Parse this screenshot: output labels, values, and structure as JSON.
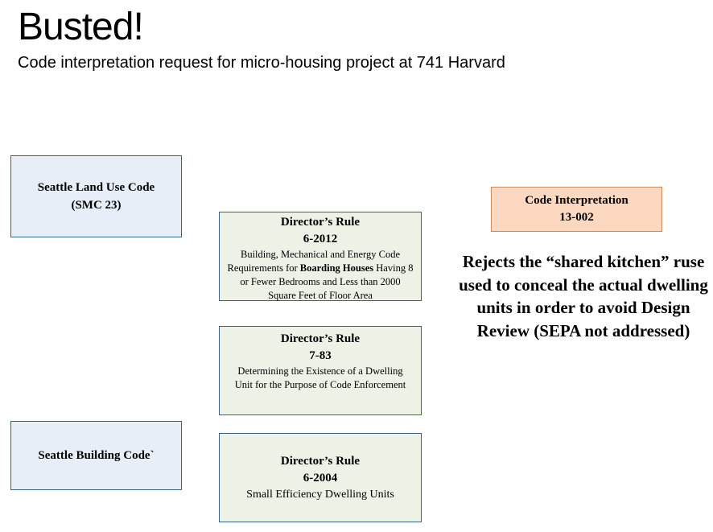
{
  "header": {
    "title": "Busted!",
    "subtitle": "Code interpretation request for micro-housing project at 741 Harvard"
  },
  "left_boxes": {
    "land_use_line1": "Seattle Land Use Code",
    "land_use_line2": "(SMC 23)",
    "building_code": "Seattle Building Code`"
  },
  "directors_rules": [
    {
      "heading": "Director’s Rule",
      "number": "6-2012",
      "desc_before": "Building, Mechanical and Energy Code Requirements for ",
      "desc_bold": "Boarding Houses",
      "desc_after": " Having 8 or Fewer Bedrooms and Less than 2000 Square Feet of Floor Area"
    },
    {
      "heading": "Director’s Rule",
      "number": "7-83",
      "desc": "Determining the Existence of a Dwelling Unit for the Purpose of  Code Enforcement"
    },
    {
      "heading": "Director’s Rule",
      "number": "6-2004",
      "desc": "Small Efficiency Dwelling Units"
    }
  ],
  "interpretation": {
    "line1": "Code Interpretation",
    "line2": "13-002",
    "statement": "Rejects the “shared kitchen” ruse used to conceal the actual dwelling units in order to avoid Design Review (SEPA not addressed)"
  },
  "colors": {
    "box_border": "#3b6283",
    "blue_fill": "#e8eef7",
    "green_fill": "#eef1e6",
    "orange_fill": "#fbd8bf"
  }
}
